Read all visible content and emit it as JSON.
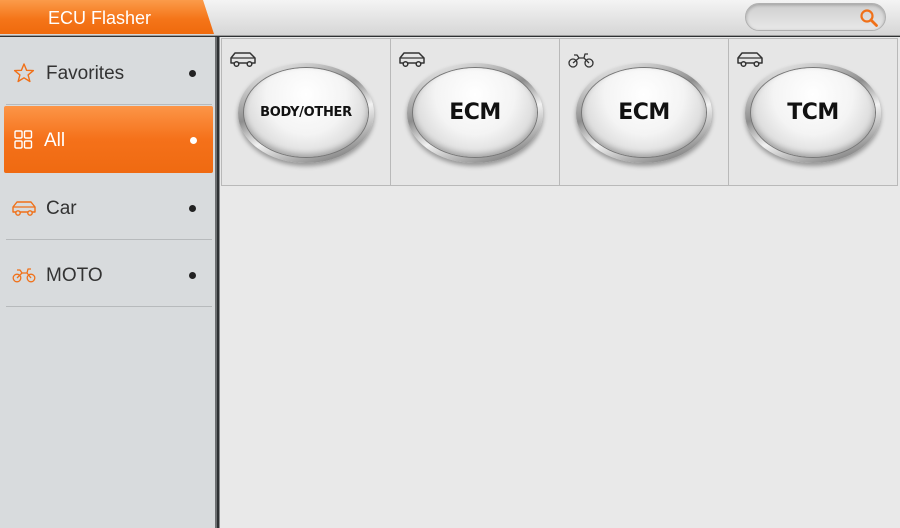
{
  "header": {
    "title": "ECU Flasher",
    "search_icon": "search-icon"
  },
  "sidebar": {
    "items": [
      {
        "label": "Favorites",
        "icon": "star-icon",
        "active": false
      },
      {
        "label": "All",
        "icon": "grid-icon",
        "active": true
      },
      {
        "label": "Car",
        "icon": "car-icon",
        "active": false
      },
      {
        "label": "MOTO",
        "icon": "motorcycle-icon",
        "active": false
      }
    ]
  },
  "modules": [
    {
      "label": "BODY/OTHER",
      "type_icon": "car-icon"
    },
    {
      "label": "ECM",
      "type_icon": "car-icon"
    },
    {
      "label": "ECM",
      "type_icon": "motorcycle-icon"
    },
    {
      "label": "TCM",
      "type_icon": "car-icon"
    }
  ],
  "colors": {
    "accent": "#f5731b",
    "sidebar_bg": "#d8dbdd",
    "content_bg": "#e9e9e9"
  }
}
